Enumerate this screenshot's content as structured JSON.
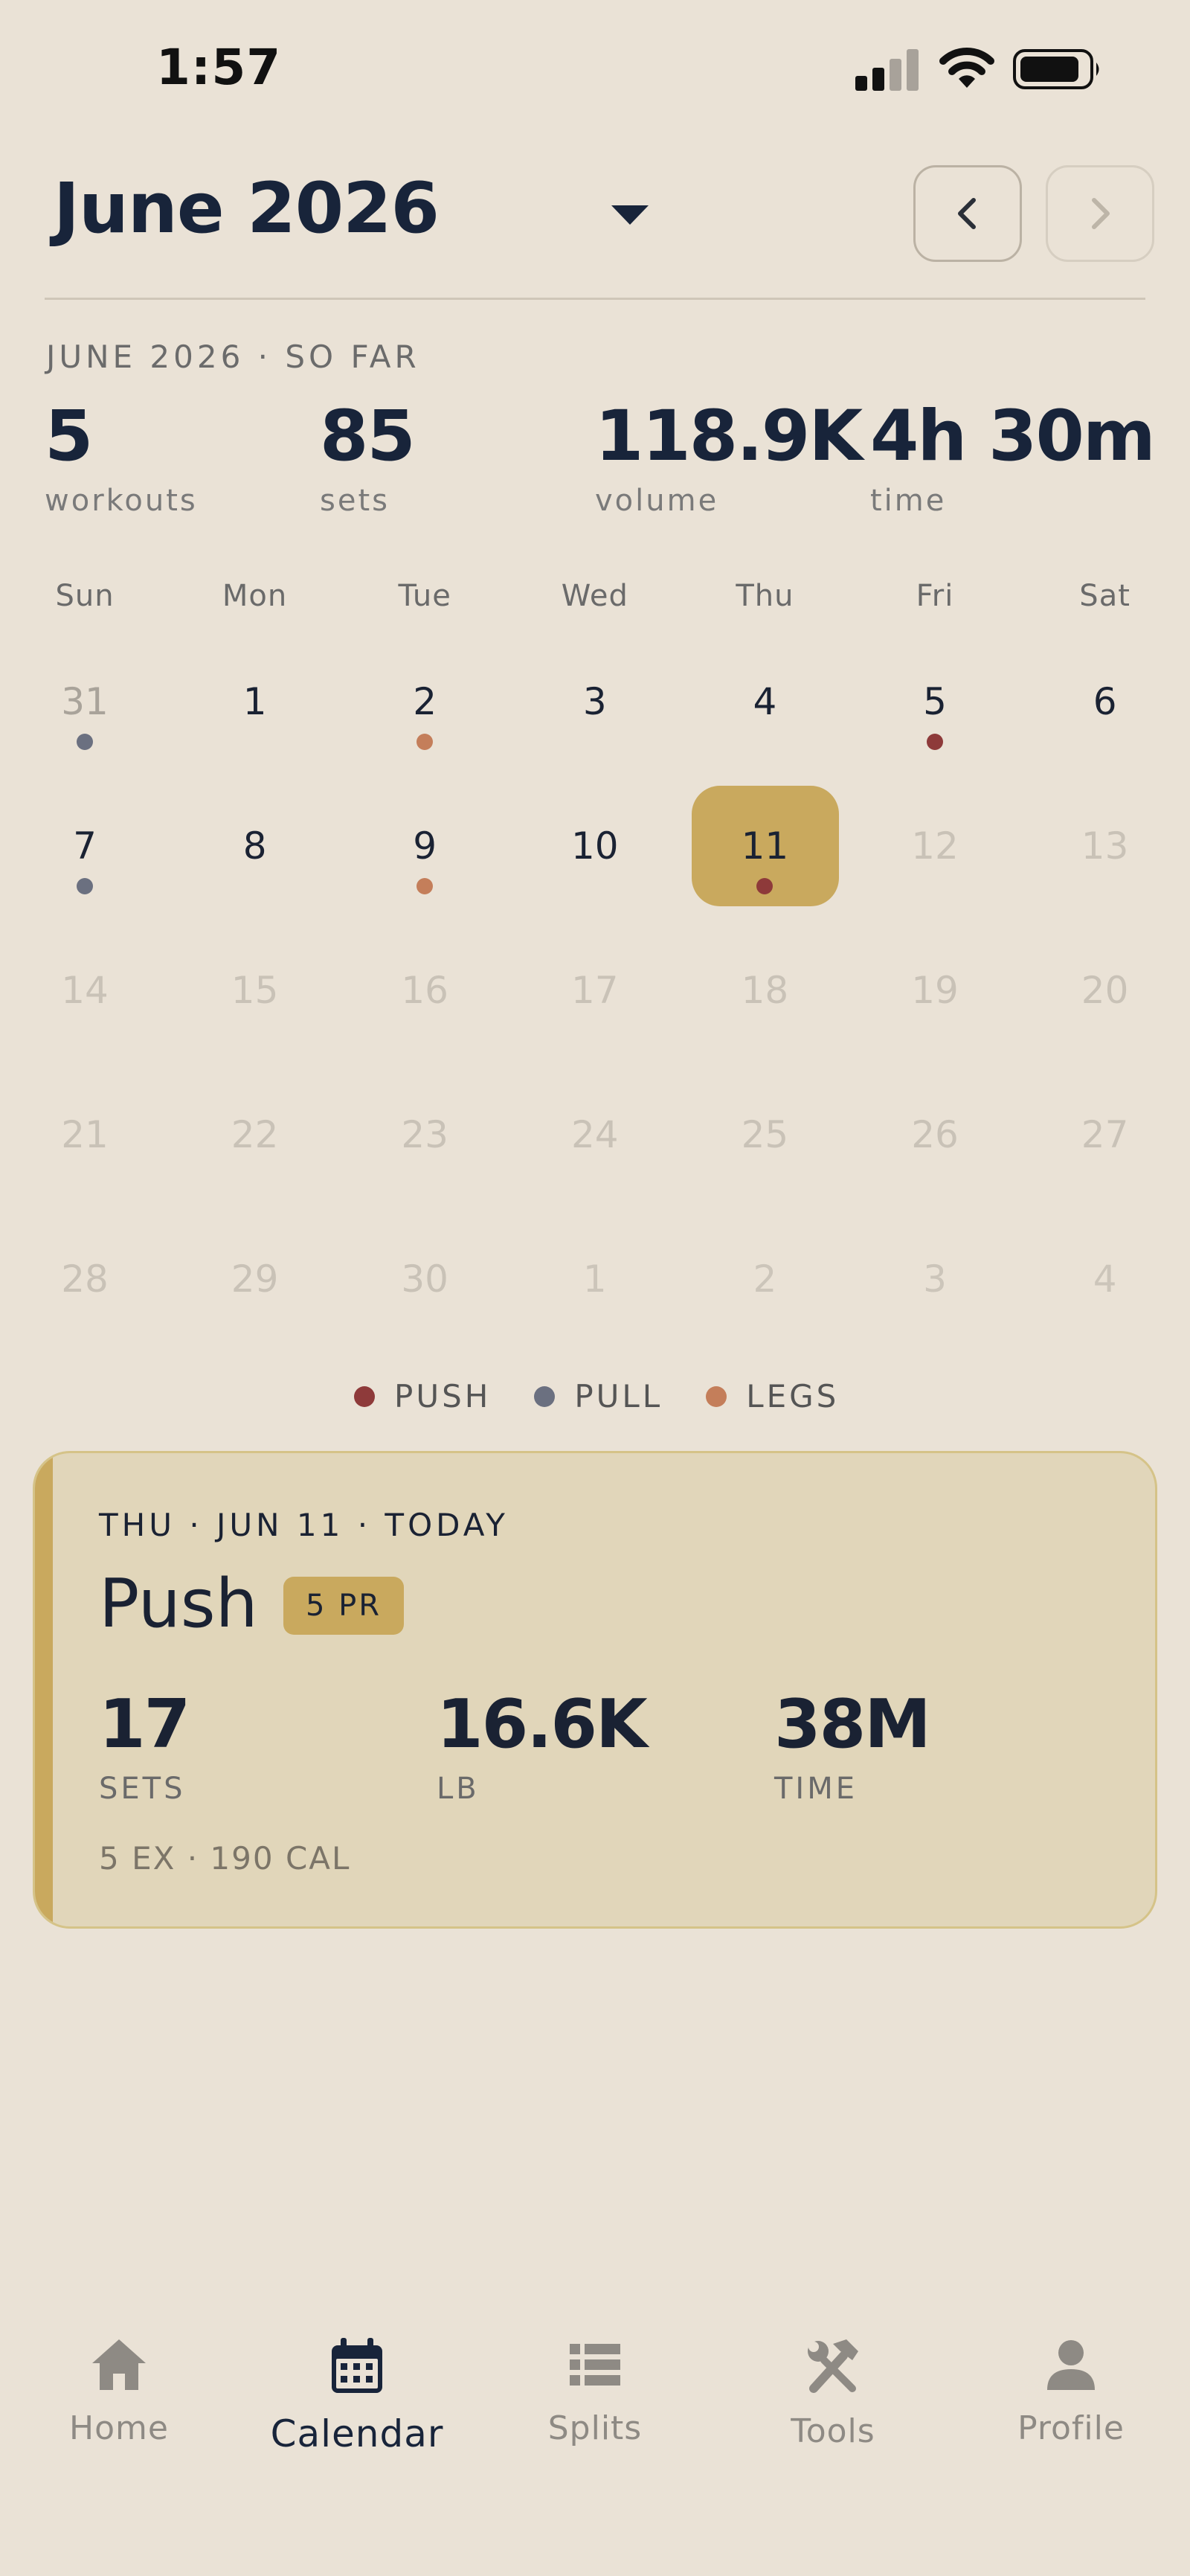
{
  "status": {
    "time": "1:57"
  },
  "header": {
    "month_label": "June 2026"
  },
  "summary": {
    "label": "JUNE 2026 · SO FAR",
    "stats": [
      {
        "value": "5",
        "label": "workouts"
      },
      {
        "value": "85",
        "label": "sets"
      },
      {
        "value": "118.9K",
        "label": "volume"
      },
      {
        "value": "4h 30m",
        "label": "time"
      }
    ]
  },
  "calendar": {
    "weekdays": [
      "Sun",
      "Mon",
      "Tue",
      "Wed",
      "Thu",
      "Fri",
      "Sat"
    ],
    "weeks": [
      [
        {
          "d": "31",
          "s": "other",
          "w": "pull"
        },
        {
          "d": "1",
          "s": "cur"
        },
        {
          "d": "2",
          "s": "cur",
          "w": "legs"
        },
        {
          "d": "3",
          "s": "cur"
        },
        {
          "d": "4",
          "s": "cur"
        },
        {
          "d": "5",
          "s": "cur",
          "w": "push"
        },
        {
          "d": "6",
          "s": "cur"
        }
      ],
      [
        {
          "d": "7",
          "s": "cur",
          "w": "pull"
        },
        {
          "d": "8",
          "s": "cur"
        },
        {
          "d": "9",
          "s": "cur",
          "w": "legs"
        },
        {
          "d": "10",
          "s": "cur"
        },
        {
          "d": "11",
          "s": "today",
          "w": "push"
        },
        {
          "d": "12",
          "s": "future"
        },
        {
          "d": "13",
          "s": "future"
        }
      ],
      [
        {
          "d": "14",
          "s": "future"
        },
        {
          "d": "15",
          "s": "future"
        },
        {
          "d": "16",
          "s": "future"
        },
        {
          "d": "17",
          "s": "future"
        },
        {
          "d": "18",
          "s": "future"
        },
        {
          "d": "19",
          "s": "future"
        },
        {
          "d": "20",
          "s": "future"
        }
      ],
      [
        {
          "d": "21",
          "s": "future"
        },
        {
          "d": "22",
          "s": "future"
        },
        {
          "d": "23",
          "s": "future"
        },
        {
          "d": "24",
          "s": "future"
        },
        {
          "d": "25",
          "s": "future"
        },
        {
          "d": "26",
          "s": "future"
        },
        {
          "d": "27",
          "s": "future"
        }
      ],
      [
        {
          "d": "28",
          "s": "future"
        },
        {
          "d": "29",
          "s": "future"
        },
        {
          "d": "30",
          "s": "future"
        },
        {
          "d": "1",
          "s": "next"
        },
        {
          "d": "2",
          "s": "next"
        },
        {
          "d": "3",
          "s": "next"
        },
        {
          "d": "4",
          "s": "next"
        }
      ]
    ],
    "workout_colors": {
      "push": "#8E3A3A",
      "pull": "#6B7080",
      "legs": "#C47E5A"
    }
  },
  "legend": [
    {
      "label": "PUSH",
      "color": "#8E3A3A"
    },
    {
      "label": "PULL",
      "color": "#6B7080"
    },
    {
      "label": "LEGS",
      "color": "#C47E5A"
    }
  ],
  "today_card": {
    "date_label": "THU · JUN 11 · TODAY",
    "title": "Push",
    "badge": "5 PR",
    "stats": [
      {
        "value": "17",
        "label": "SETS"
      },
      {
        "value": "16.6K",
        "label": "LB"
      },
      {
        "value": "38M",
        "label": "TIME"
      }
    ],
    "footer": "5 EX · 190 CAL"
  },
  "nav": {
    "tabs": [
      {
        "label": "Home",
        "icon": "home-icon"
      },
      {
        "label": "Calendar",
        "icon": "calendar-icon",
        "active": true
      },
      {
        "label": "Splits",
        "icon": "list-icon"
      },
      {
        "label": "Tools",
        "icon": "tools-icon"
      },
      {
        "label": "Profile",
        "icon": "person-icon"
      }
    ]
  },
  "colors": {
    "background": "#EAE2D6",
    "accent": "#C9A95E",
    "text": "#18243A"
  }
}
